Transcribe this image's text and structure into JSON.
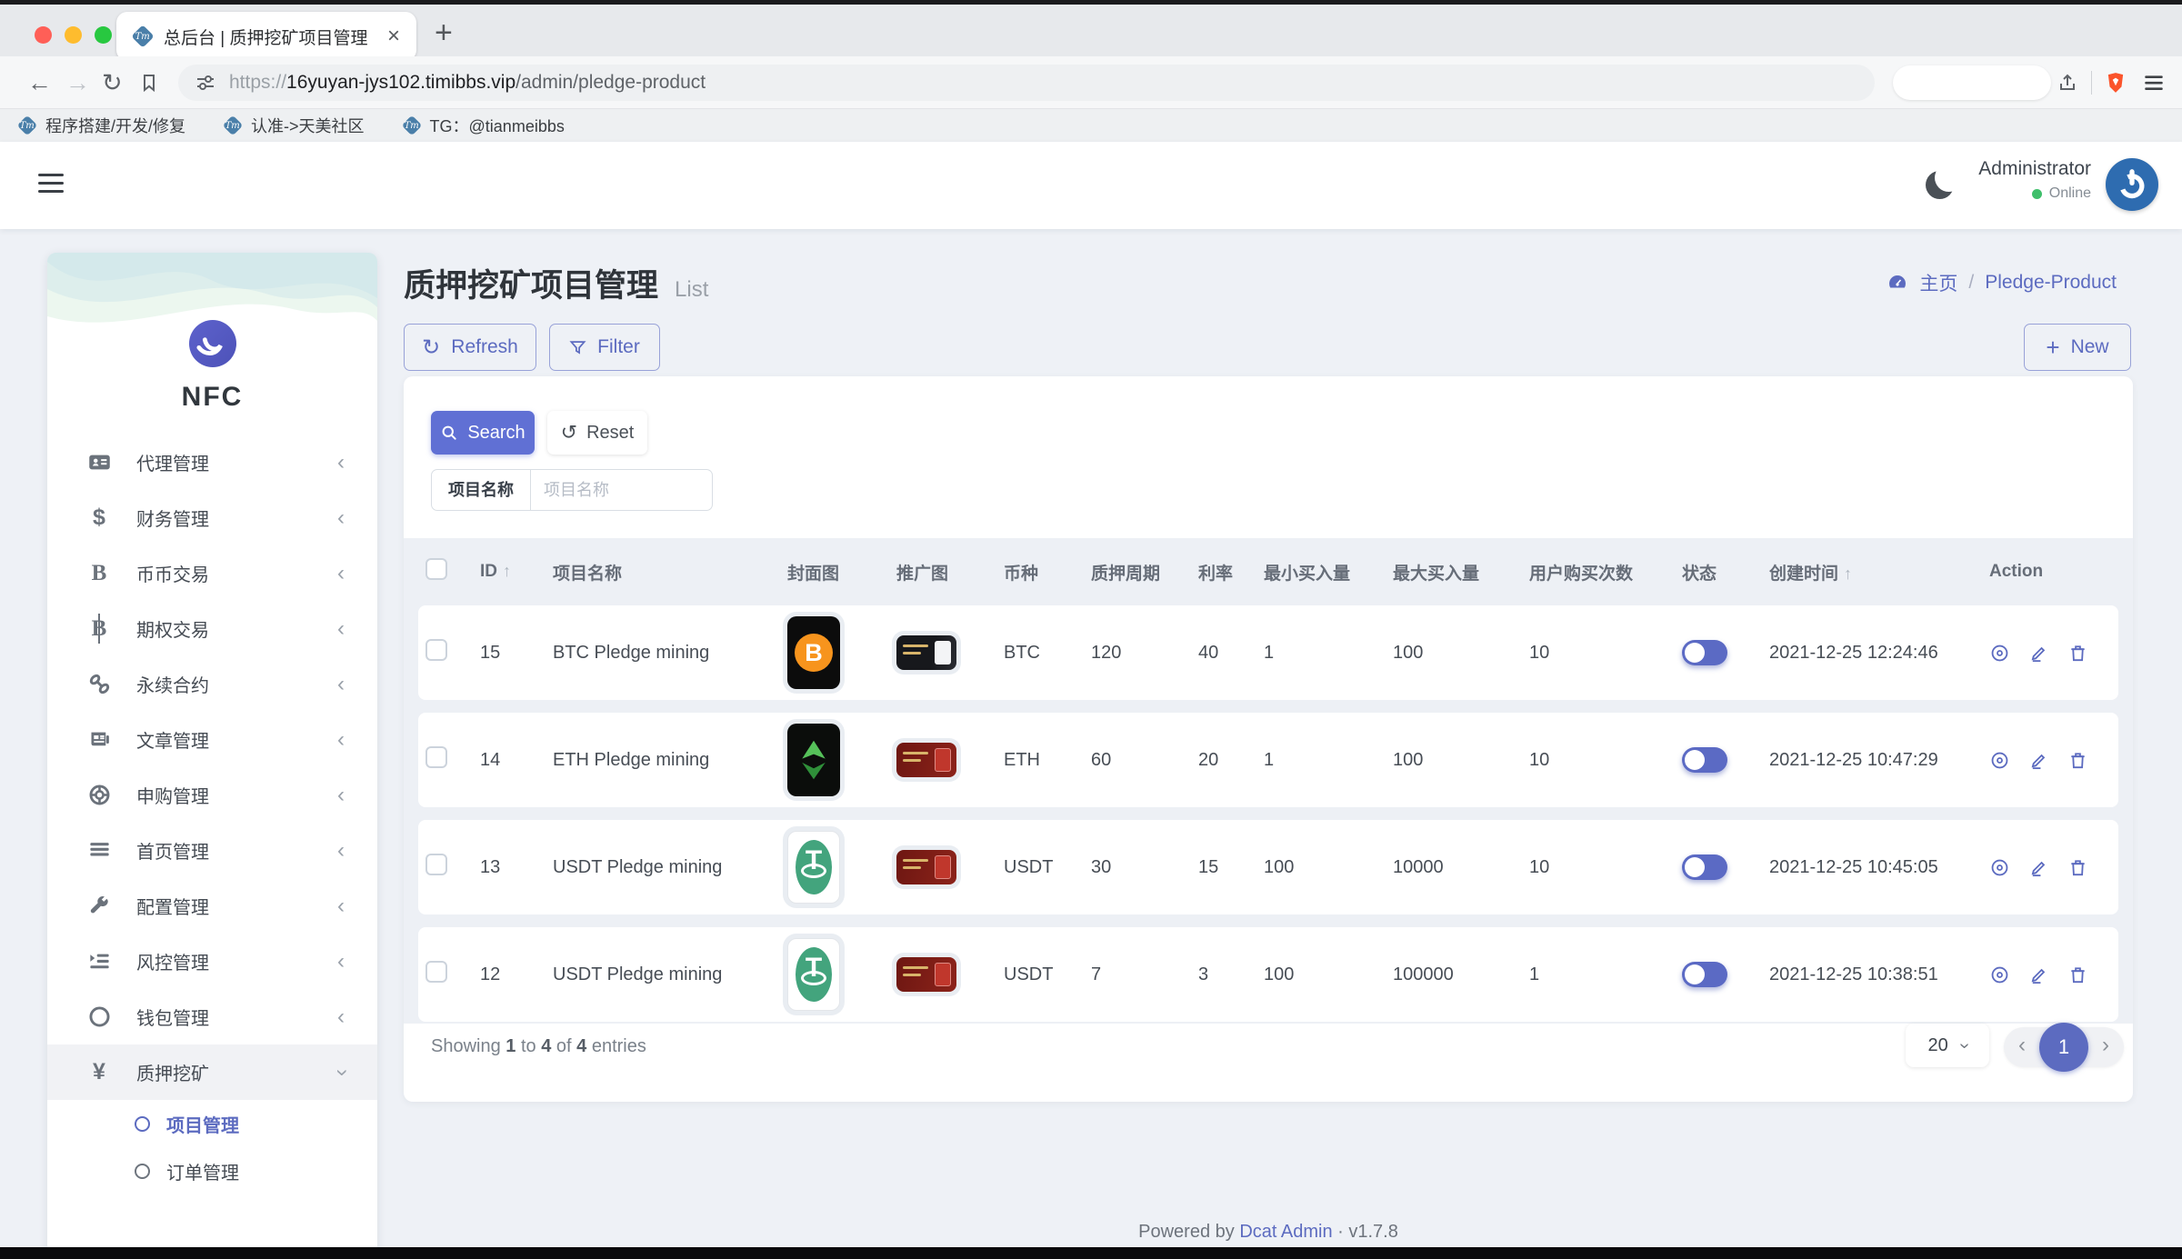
{
  "browser": {
    "tab_title": "总后台 | 质押挖矿项目管理",
    "favicon_text": "Tm",
    "url_scheme": "https://",
    "url_host": "16yuyan-jys102.timibbs.vip",
    "url_path": "/admin/pledge-product",
    "bookmarks": [
      {
        "label": "程序搭建/开发/修复",
        "icon": "tm-diamond-icon"
      },
      {
        "label": "认准->天美社区",
        "icon": "tm-diamond-icon"
      },
      {
        "label": "TG：@tianmeibbs",
        "icon": "tm-diamond-icon"
      }
    ]
  },
  "navbar": {
    "user_name": "Administrator",
    "user_status": "Online"
  },
  "sidebar": {
    "brand": "NFC",
    "items": [
      {
        "label": "代理管理",
        "icon": "id-card-icon"
      },
      {
        "label": "财务管理",
        "icon": "dollar-icon"
      },
      {
        "label": "币币交易",
        "icon": "coin-b-icon"
      },
      {
        "label": "期权交易",
        "icon": "baht-icon"
      },
      {
        "label": "永续合约",
        "icon": "chain-link-icon"
      },
      {
        "label": "文章管理",
        "icon": "newspaper-icon"
      },
      {
        "label": "申购管理",
        "icon": "life-ring-icon"
      },
      {
        "label": "首页管理",
        "icon": "list-bars-icon"
      },
      {
        "label": "配置管理",
        "icon": "wrench-icon"
      },
      {
        "label": "风控管理",
        "icon": "indent-list-icon"
      },
      {
        "label": "钱包管理",
        "icon": "circle-icon"
      },
      {
        "label": "质押挖矿",
        "icon": "yen-icon",
        "expanded": true,
        "children": [
          {
            "label": "项目管理",
            "active": true
          },
          {
            "label": "订单管理",
            "active": false
          }
        ]
      }
    ]
  },
  "page": {
    "title": "质押挖矿项目管理",
    "subtitle": "List",
    "breadcrumb": {
      "home": "主页",
      "separator": "/",
      "current": "Pledge-Product"
    },
    "toolbar": {
      "refresh_label": "Refresh",
      "filter_label": "Filter",
      "new_label": "New"
    },
    "search": {
      "search_label": "Search",
      "reset_label": "Reset",
      "field_label": "项目名称",
      "placeholder": "项目名称"
    }
  },
  "table": {
    "headers": [
      "ID",
      "项目名称",
      "封面图",
      "推广图",
      "币种",
      "质押周期",
      "利率",
      "最小买入量",
      "最大买入量",
      "用户购买次数",
      "状态",
      "创建时间",
      "Action"
    ],
    "rows": [
      {
        "id": "15",
        "name": "BTC Pledge mining",
        "cover_icon": "btc-cover-image",
        "promo_icon": "promo-banner-dark",
        "coin": "BTC",
        "period": "120",
        "rate": "40",
        "min_buy": "1",
        "max_buy": "100",
        "buy_times": "10",
        "status_on": true,
        "created_at": "2021-12-25 12:24:46"
      },
      {
        "id": "14",
        "name": "ETH Pledge mining",
        "cover_icon": "eth-cover-image",
        "promo_icon": "promo-banner-red",
        "coin": "ETH",
        "period": "60",
        "rate": "20",
        "min_buy": "1",
        "max_buy": "100",
        "buy_times": "10",
        "status_on": true,
        "created_at": "2021-12-25 10:47:29"
      },
      {
        "id": "13",
        "name": "USDT Pledge mining",
        "cover_icon": "usdt-cover-image",
        "promo_icon": "promo-banner-red",
        "coin": "USDT",
        "period": "30",
        "rate": "15",
        "min_buy": "100",
        "max_buy": "10000",
        "buy_times": "10",
        "status_on": true,
        "created_at": "2021-12-25 10:45:05"
      },
      {
        "id": "12",
        "name": "USDT Pledge mining",
        "cover_icon": "usdt-cover-image",
        "promo_icon": "promo-banner-red",
        "coin": "USDT",
        "period": "7",
        "rate": "3",
        "min_buy": "100",
        "max_buy": "100000",
        "buy_times": "1",
        "status_on": true,
        "created_at": "2021-12-25 10:38:51"
      }
    ],
    "summary": {
      "showing": "Showing",
      "from": "1",
      "word_to": "to",
      "to": "4",
      "word_of": "of",
      "total": "4",
      "word_entries": "entries"
    },
    "page_size": "20",
    "current_page": "1",
    "action_icons": [
      "view-icon",
      "edit-icon",
      "delete-icon"
    ]
  },
  "footer": {
    "powered_by": "Powered by",
    "link_label": "Dcat Admin",
    "separator": "·",
    "version": "v1.7.8"
  },
  "colors": {
    "primary": "#5c6bc0",
    "search_button": "#6070d4",
    "online_dot": "#3fbf6b",
    "brave_shield": "#fb542b",
    "btc_orange": "#f7941d",
    "usdt_green": "#43a47d"
  }
}
